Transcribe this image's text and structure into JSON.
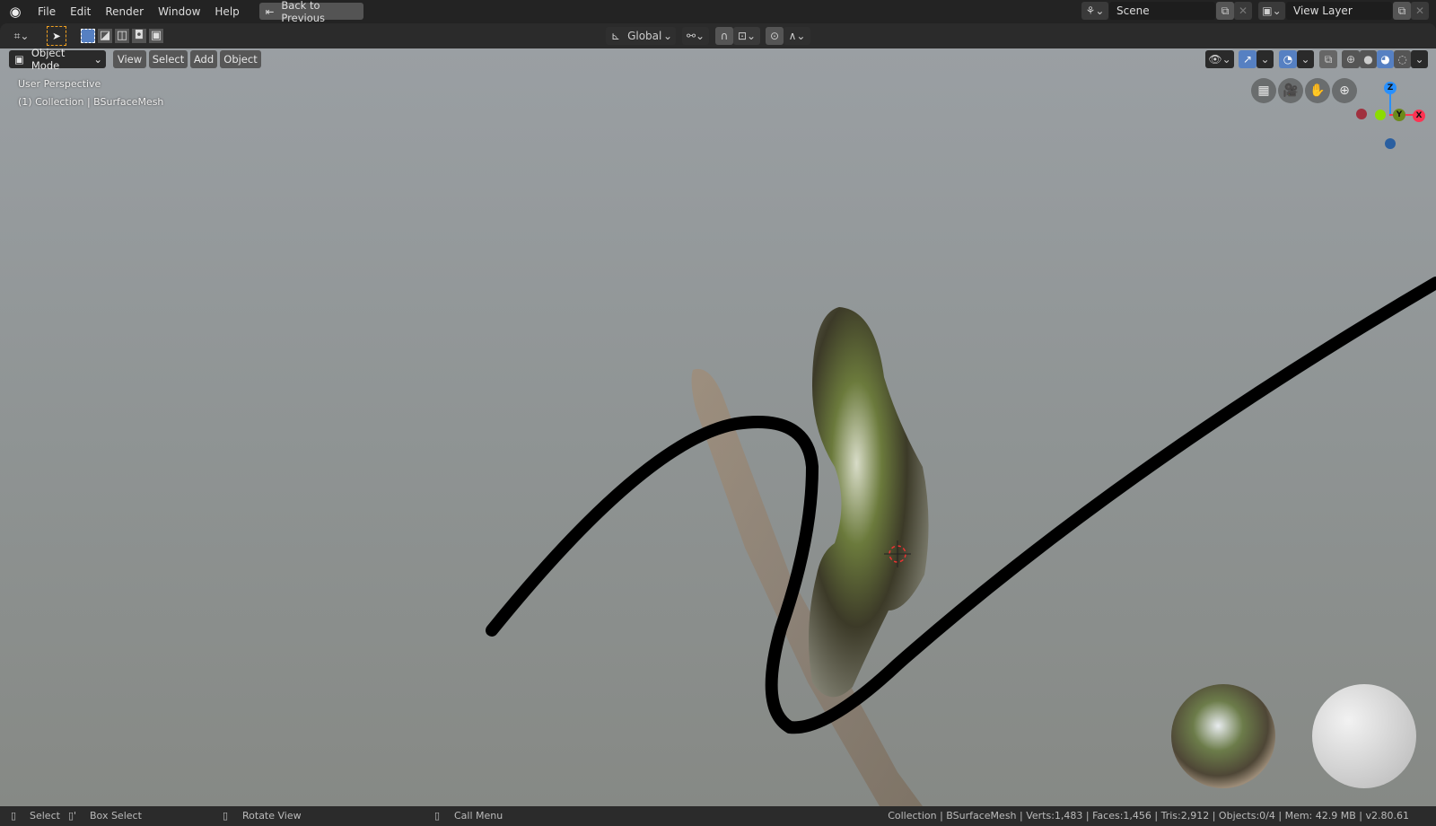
{
  "topbar": {
    "menus": [
      "File",
      "Edit",
      "Render",
      "Window",
      "Help"
    ],
    "back_button": "Back to Previous",
    "scene": "Scene",
    "view_layer": "View Layer"
  },
  "tool_header": {
    "transform_orientation": "Global"
  },
  "viewport_header": {
    "mode": "Object Mode",
    "menus": [
      "View",
      "Select",
      "Add",
      "Object"
    ]
  },
  "overlay": {
    "view_name": "User Perspective",
    "collection": "(1) Collection | BSurfaceMesh"
  },
  "gizmo": {
    "z": "Z",
    "x": "X",
    "y": "Y"
  },
  "statusbar": {
    "select": "Select",
    "box_select": "Box Select",
    "rotate_view": "Rotate View",
    "call_menu": "Call Menu",
    "stats": "Collection | BSurfaceMesh | Verts:1,483 | Faces:1,456 | Tris:2,912 | Objects:0/4 | Mem: 42.9 MB | v2.80.61"
  },
  "colors": {
    "accent": "#5680c2",
    "x_axis": "#ff3352",
    "y_axis": "#8bdc00",
    "z_axis": "#2890ff"
  }
}
